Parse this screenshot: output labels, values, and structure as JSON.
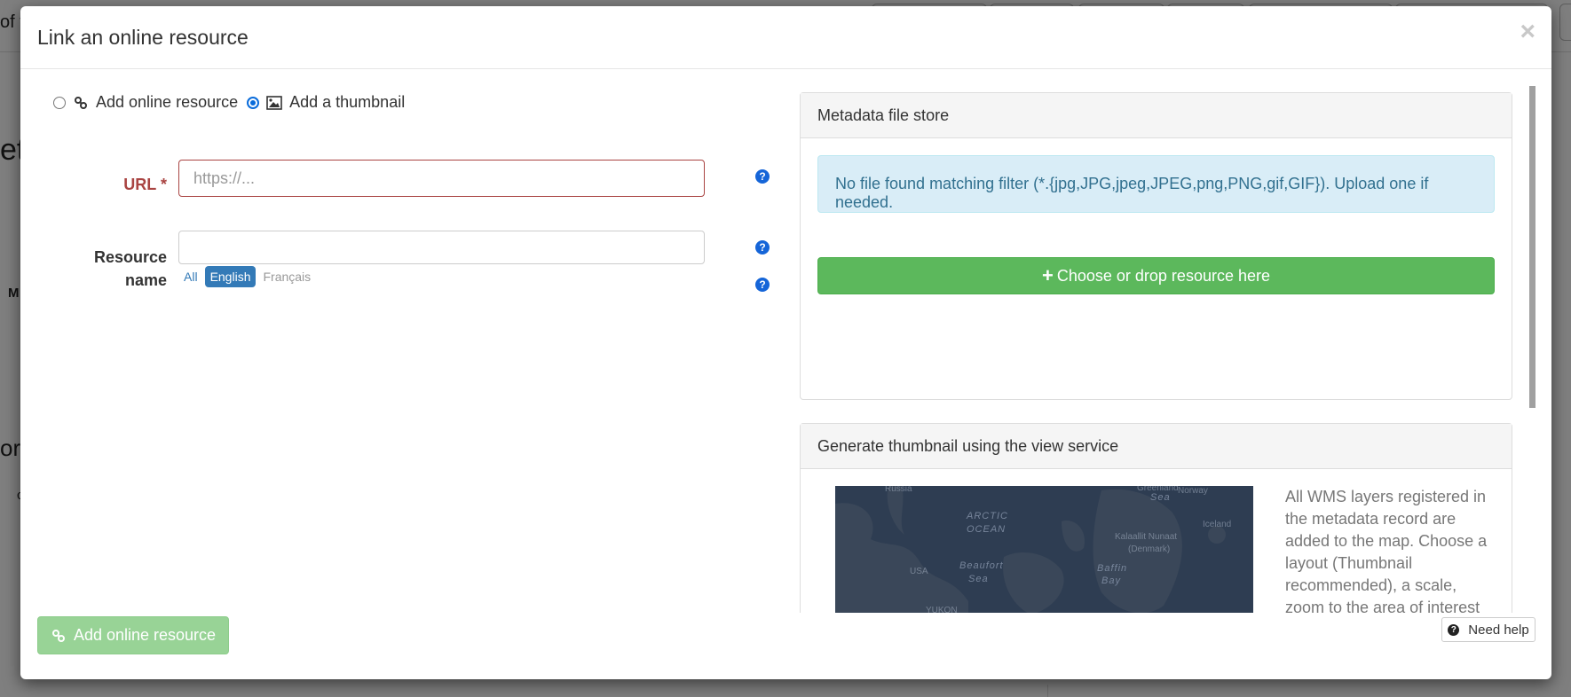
{
  "background": {
    "fragments": [
      "of t",
      "et",
      "M",
      "or",
      "c"
    ]
  },
  "modal": {
    "title": "Link an online resource",
    "close_label": "×",
    "mode": {
      "options": [
        {
          "label": "Add online resource",
          "icon": "link-icon",
          "selected": false
        },
        {
          "label": "Add a thumbnail",
          "icon": "image-icon",
          "selected": true
        }
      ]
    },
    "form": {
      "url": {
        "label": "URL",
        "required_mark": "*",
        "placeholder": "https://...",
        "value": ""
      },
      "resource_name": {
        "label_line1": "Resource",
        "label_line2": "name",
        "value": ""
      },
      "languages": [
        {
          "label": "All",
          "active": false
        },
        {
          "label": "English",
          "active": true
        },
        {
          "label": "Français",
          "active": false
        }
      ],
      "help_glyph": "?"
    },
    "file_store": {
      "heading": "Metadata file store",
      "alert": "No file found matching filter (*.{jpg,JPG,jpeg,JPEG,png,PNG,gif,GIF}). Upload one if needed.",
      "drop_button": "Choose or drop resource here",
      "drop_icon": "+"
    },
    "view_service": {
      "heading": "Generate thumbnail using the view service",
      "map_labels": [
        "Russia",
        "ARCTIC",
        "OCEAN",
        "Greenland",
        "Sea",
        "Norway",
        "Iceland",
        "Kalaallit Nunaat",
        "(Denmark)",
        "USA",
        "Beaufort",
        "Sea",
        "Baffin",
        "Bay",
        "YUKON"
      ],
      "description": "All WMS layers registered in the metadata record are added to the map. Choose a layout (Thumbnail recommended), a scale, zoom to the area of interest"
    },
    "footer": {
      "add_button": "Add online resource",
      "help_button": "Need help",
      "help_glyph": "?"
    },
    "colors": {
      "error": "#a94442",
      "primary": "#337ab7",
      "success": "#5cb85c",
      "success_disabled": "#98d396",
      "info_bg": "#d9edf7",
      "info_text": "#31708f",
      "help_icon": "#1565d8"
    }
  }
}
